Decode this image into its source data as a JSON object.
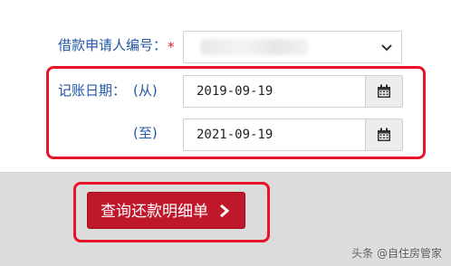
{
  "form": {
    "applicant_label": "借款申请人编号：",
    "required_mark": "*",
    "date_label": "记账日期：",
    "from_label": "(从)",
    "to_label": "(至)",
    "from_date": "2019-09-19",
    "to_date": "2021-09-19"
  },
  "actions": {
    "query_label": "查询还款明细单"
  },
  "watermark": "头条 @自住房管家",
  "colors": {
    "label_blue": "#2457a8",
    "button_red": "#c0182b",
    "highlight_red": "#e8142a"
  },
  "icons": {
    "select": "chevron-down-icon",
    "calendar": "calendar-icon",
    "button": "chevron-right-icon"
  }
}
